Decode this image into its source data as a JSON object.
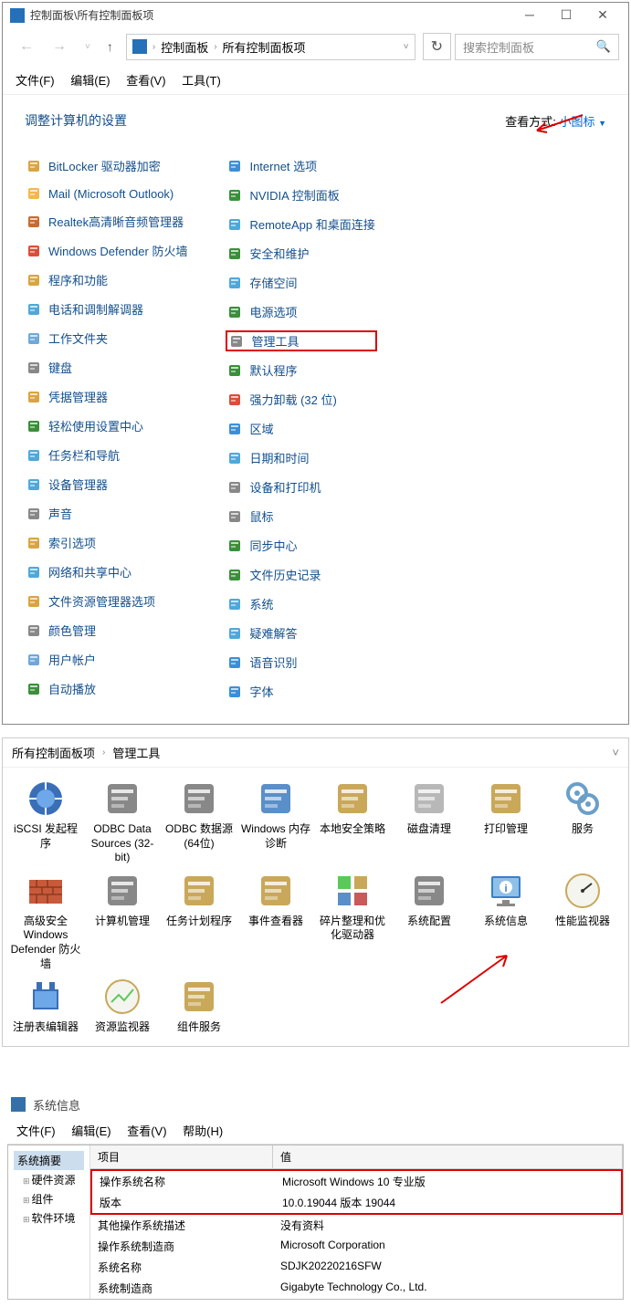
{
  "titlebar": {
    "title": "控制面板\\所有控制面板项"
  },
  "breadcrumb": {
    "p1": "控制面板",
    "p2": "所有控制面板项"
  },
  "search": {
    "placeholder": "搜索控制面板"
  },
  "menu": {
    "file": "文件(F)",
    "edit": "编辑(E)",
    "view": "查看(V)",
    "tools": "工具(T)"
  },
  "heading": "调整计算机的设置",
  "viewby": {
    "label": "查看方式:",
    "value": "小图标"
  },
  "col1": [
    {
      "n": "bitlocker",
      "l": "BitLocker 驱动器加密"
    },
    {
      "n": "mail",
      "l": "Mail (Microsoft Outlook)"
    },
    {
      "n": "realtek",
      "l": "Realtek高清晰音频管理器"
    },
    {
      "n": "defender",
      "l": "Windows Defender 防火墙"
    },
    {
      "n": "programs",
      "l": "程序和功能"
    },
    {
      "n": "phone",
      "l": "电话和调制解调器"
    },
    {
      "n": "workfolders",
      "l": "工作文件夹"
    },
    {
      "n": "keyboard",
      "l": "键盘"
    },
    {
      "n": "credmgr",
      "l": "凭据管理器"
    },
    {
      "n": "ease",
      "l": "轻松使用设置中心"
    },
    {
      "n": "taskbar",
      "l": "任务栏和导航"
    },
    {
      "n": "devmgr",
      "l": "设备管理器"
    },
    {
      "n": "sound",
      "l": "声音"
    },
    {
      "n": "indexing",
      "l": "索引选项"
    },
    {
      "n": "network",
      "l": "网络和共享中心"
    },
    {
      "n": "explorer",
      "l": "文件资源管理器选项"
    },
    {
      "n": "color",
      "l": "颜色管理"
    },
    {
      "n": "users",
      "l": "用户帐户"
    },
    {
      "n": "autoplay",
      "l": "自动播放"
    }
  ],
  "col2": [
    {
      "n": "internet",
      "l": "Internet 选项"
    },
    {
      "n": "nvidia",
      "l": "NVIDIA 控制面板"
    },
    {
      "n": "remoteapp",
      "l": "RemoteApp 和桌面连接"
    },
    {
      "n": "security",
      "l": "安全和维护"
    },
    {
      "n": "storage",
      "l": "存储空间"
    },
    {
      "n": "power",
      "l": "电源选项"
    },
    {
      "n": "admintools",
      "l": "管理工具",
      "hl": true
    },
    {
      "n": "defaults",
      "l": "默认程序"
    },
    {
      "n": "forceuninstall",
      "l": "强力卸载 (32 位)"
    },
    {
      "n": "region",
      "l": "区域"
    },
    {
      "n": "datetime",
      "l": "日期和时间"
    },
    {
      "n": "devprint",
      "l": "设备和打印机"
    },
    {
      "n": "mouse",
      "l": "鼠标"
    },
    {
      "n": "sync",
      "l": "同步中心"
    },
    {
      "n": "filehistory",
      "l": "文件历史记录"
    },
    {
      "n": "system",
      "l": "系统"
    },
    {
      "n": "troubleshoot",
      "l": "疑难解答"
    },
    {
      "n": "speech",
      "l": "语音识别"
    },
    {
      "n": "fonts",
      "l": "字体"
    }
  ],
  "bc2": {
    "p1": "所有控制面板项",
    "p2": "管理工具"
  },
  "tools": [
    {
      "n": "iscsi",
      "l": "iSCSI 发起程序"
    },
    {
      "n": "odbc32",
      "l": "ODBC Data Sources (32-bit)"
    },
    {
      "n": "odbc64",
      "l": "ODBC 数据源(64位)"
    },
    {
      "n": "memdiag",
      "l": "Windows 内存诊断"
    },
    {
      "n": "localsec",
      "l": "本地安全策略"
    },
    {
      "n": "diskcleanup",
      "l": "磁盘清理"
    },
    {
      "n": "printmgmt",
      "l": "打印管理"
    },
    {
      "n": "services",
      "l": "服务"
    },
    {
      "n": "advfirewall",
      "l": "高级安全 Windows Defender 防火墙"
    },
    {
      "n": "compmgmt",
      "l": "计算机管理"
    },
    {
      "n": "tasksched",
      "l": "任务计划程序"
    },
    {
      "n": "eventvwr",
      "l": "事件查看器"
    },
    {
      "n": "defrag",
      "l": "碎片整理和优化驱动器"
    },
    {
      "n": "msconfig",
      "l": "系统配置"
    },
    {
      "n": "sysinfo",
      "l": "系统信息"
    },
    {
      "n": "perfmon",
      "l": "性能监视器"
    },
    {
      "n": "regedit",
      "l": "注册表编辑器"
    },
    {
      "n": "resmon",
      "l": "资源监视器"
    },
    {
      "n": "compsvc",
      "l": "组件服务"
    }
  ],
  "sysinfo": {
    "title": "系统信息",
    "menu": {
      "file": "文件(F)",
      "edit": "编辑(E)",
      "view": "查看(V)",
      "help": "帮助(H)"
    },
    "tree": {
      "root": "系统摘要",
      "c1": "硬件资源",
      "c2": "组件",
      "c3": "软件环境"
    },
    "hdr": {
      "c1": "项目",
      "c2": "值"
    },
    "rows": [
      {
        "k": "操作系统名称",
        "v": "Microsoft Windows 10 专业版",
        "hl": true
      },
      {
        "k": "版本",
        "v": "10.0.19044 版本 19044",
        "hl": true
      },
      {
        "k": "其他操作系统描述",
        "v": "没有资料"
      },
      {
        "k": "操作系统制造商",
        "v": "Microsoft Corporation"
      },
      {
        "k": "系统名称",
        "v": "SDJK20220216SFW"
      },
      {
        "k": "系统制造商",
        "v": "Gigabyte Technology Co., Ltd."
      }
    ]
  },
  "colors": {
    "bitlocker": "#d9a441",
    "mail": "#f2b84b",
    "realtek": "#c96b2e",
    "defender": "#d94f3a",
    "programs": "#d9a441",
    "phone": "#4fa8d9",
    "workfolders": "#6fa8d9",
    "keyboard": "#888",
    "credmgr": "#d9a441",
    "ease": "#3a8f3a",
    "taskbar": "#4fa8d9",
    "devmgr": "#4fa8d9",
    "sound": "#888",
    "indexing": "#d9a441",
    "network": "#4fa8d9",
    "explorer": "#d9a441",
    "color": "#888",
    "users": "#6fa8d9",
    "autoplay": "#3a8f3a",
    "internet": "#3a8fd9",
    "nvidia": "#3a8f3a",
    "remoteapp": "#4fa8d9",
    "security": "#3a8f3a",
    "storage": "#4fa8d9",
    "power": "#3a8f3a",
    "admintools": "#888",
    "defaults": "#3a8f3a",
    "forceuninstall": "#d94f3a",
    "region": "#3a8fd9",
    "datetime": "#4fa8d9",
    "devprint": "#888",
    "mouse": "#888",
    "sync": "#3a8f3a",
    "filehistory": "#3a8f3a",
    "system": "#4fa8d9",
    "troubleshoot": "#4fa8d9",
    "speech": "#3a8fd9",
    "fonts": "#3a8fd9"
  },
  "toolColors": {
    "iscsi": "#3a6fb8",
    "odbc32": "#888",
    "odbc64": "#888",
    "memdiag": "#5a8fc9",
    "localsec": "#c9a85a",
    "diskcleanup": "#b8b8b8",
    "printmgmt": "#c9a85a",
    "services": "#6a9fc9",
    "advfirewall": "#c85a3a",
    "compmgmt": "#888",
    "tasksched": "#c9a85a",
    "eventvwr": "#c9a85a",
    "defrag": "#5ac95a",
    "msconfig": "#888",
    "sysinfo": "#3a7fc9",
    "perfmon": "#c9a85a",
    "regedit": "#3a6fb8",
    "resmon": "#c9a85a",
    "compsvc": "#c9a85a"
  }
}
